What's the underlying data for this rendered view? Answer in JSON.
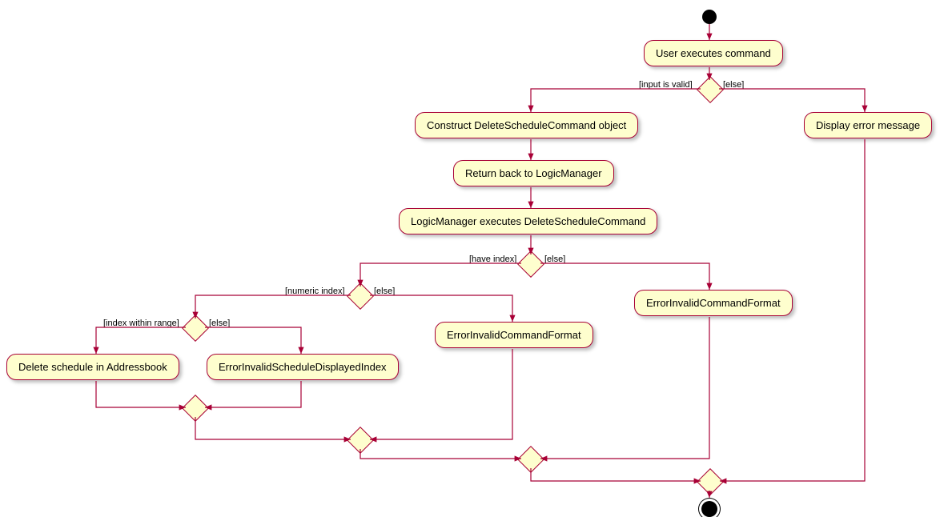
{
  "nodes": {
    "n1": "User executes command",
    "n2": "Construct DeleteScheduleCommand object",
    "n3": "Return back to LogicManager",
    "n4": "LogicManager executes DeleteScheduleCommand",
    "n5": "Display error message",
    "n6": "ErrorInvalidCommandFormat",
    "n7": "ErrorInvalidCommandFormat",
    "n8": "Delete schedule in Addressbook",
    "n9": "ErrorInvalidScheduleDisplayedIndex"
  },
  "guards": {
    "g1": "[input is valid]",
    "g1e": "[else]",
    "g2": "[have index]",
    "g2e": "[else]",
    "g3": "[numeric index]",
    "g3e": "[else]",
    "g4": "[index within range]",
    "g4e": "[else]"
  }
}
